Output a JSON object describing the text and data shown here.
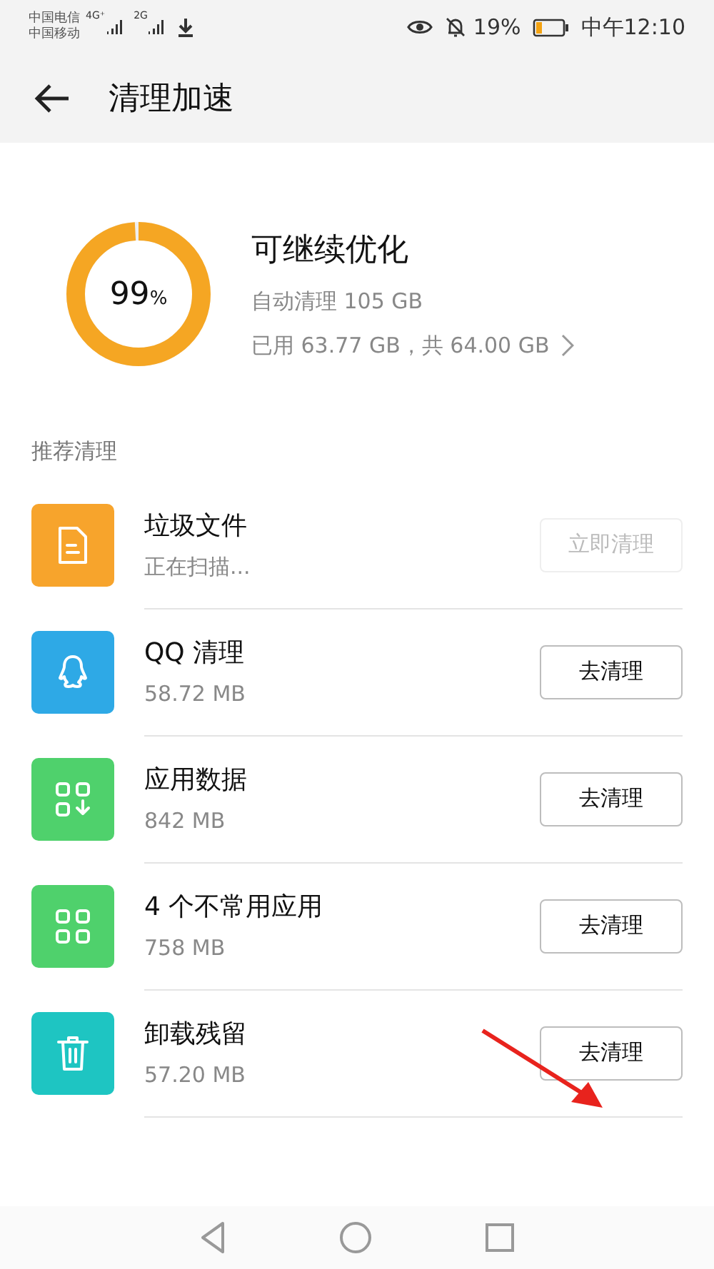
{
  "status_bar": {
    "carriers": [
      "中国电信",
      "中国移动"
    ],
    "signal_1": "4G⁺",
    "signal_2": "2G",
    "battery": "19%",
    "time": "中午12:10"
  },
  "header": {
    "title": "清理加速"
  },
  "summary": {
    "percent": "99",
    "unit": "%",
    "level": 0.99,
    "title": "可继续优化",
    "auto_clean": "自动清理 105 GB",
    "usage": "已用 63.77 GB，共 64.00 GB"
  },
  "section_title": "推荐清理",
  "items": [
    {
      "kind": "file",
      "color": "#f7a42c",
      "title": "垃圾文件",
      "subtitle": "正在扫描...",
      "button": "立即清理",
      "disabled": true
    },
    {
      "kind": "qq",
      "color": "#2ea9e6",
      "title": "QQ 清理",
      "subtitle": "58.72 MB",
      "button": "去清理",
      "disabled": false
    },
    {
      "kind": "appdata",
      "color": "#4fd16c",
      "title": "应用数据",
      "subtitle": "842 MB",
      "button": "去清理",
      "disabled": false
    },
    {
      "kind": "apps",
      "color": "#4fd16c",
      "title": "4 个不常用应用",
      "subtitle": "758 MB",
      "button": "去清理",
      "disabled": false
    },
    {
      "kind": "trash",
      "color": "#1ec5c2",
      "title": "卸载残留",
      "subtitle": "57.20 MB",
      "button": "去清理",
      "disabled": false
    }
  ]
}
